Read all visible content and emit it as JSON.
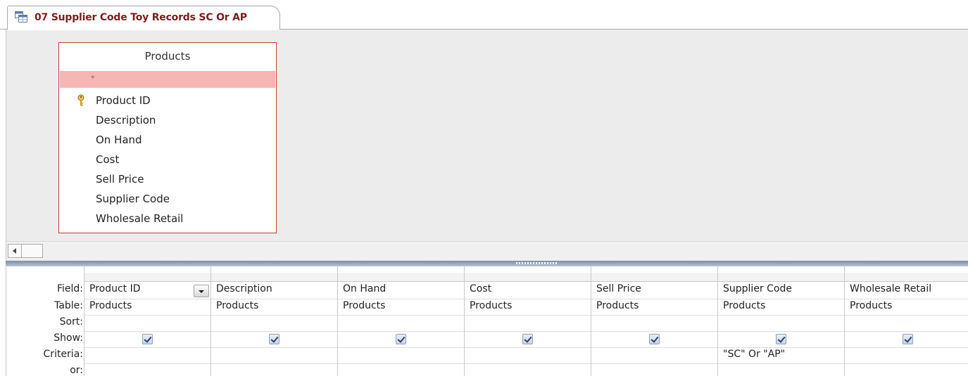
{
  "tab": {
    "title": "07 Supplier Code Toy Records SC Or AP",
    "icon": "query-icon"
  },
  "design": {
    "table": {
      "title": "Products",
      "star": "*",
      "fields": [
        "Product ID",
        "Description",
        "On Hand",
        "Cost",
        "Sell Price",
        "Supplier Code",
        "Wholesale Retail"
      ],
      "primary_key": "Product ID"
    }
  },
  "grid": {
    "row_labels": [
      "Field:",
      "Table:",
      "Sort:",
      "Show:",
      "Criteria:",
      "or:"
    ],
    "columns": [
      {
        "field": "Product ID",
        "table": "Products",
        "sort": "",
        "show": true,
        "criteria": ""
      },
      {
        "field": "Description",
        "table": "Products",
        "sort": "",
        "show": true,
        "criteria": ""
      },
      {
        "field": "On Hand",
        "table": "Products",
        "sort": "",
        "show": true,
        "criteria": ""
      },
      {
        "field": "Cost",
        "table": "Products",
        "sort": "",
        "show": true,
        "criteria": ""
      },
      {
        "field": "Sell Price",
        "table": "Products",
        "sort": "",
        "show": true,
        "criteria": ""
      },
      {
        "field": "Supplier Code",
        "table": "Products",
        "sort": "",
        "show": true,
        "criteria": "\"SC\" Or \"AP\""
      },
      {
        "field": "Wholesale Retail",
        "table": "Products",
        "sort": "",
        "show": true,
        "criteria": ""
      }
    ]
  },
  "colors": {
    "tab_title": "#7a1c1c",
    "table_border": "#c0403a",
    "star_row_bg": "#f8b5b5",
    "design_bg": "#ececec",
    "splitter": "#7d8da3"
  }
}
